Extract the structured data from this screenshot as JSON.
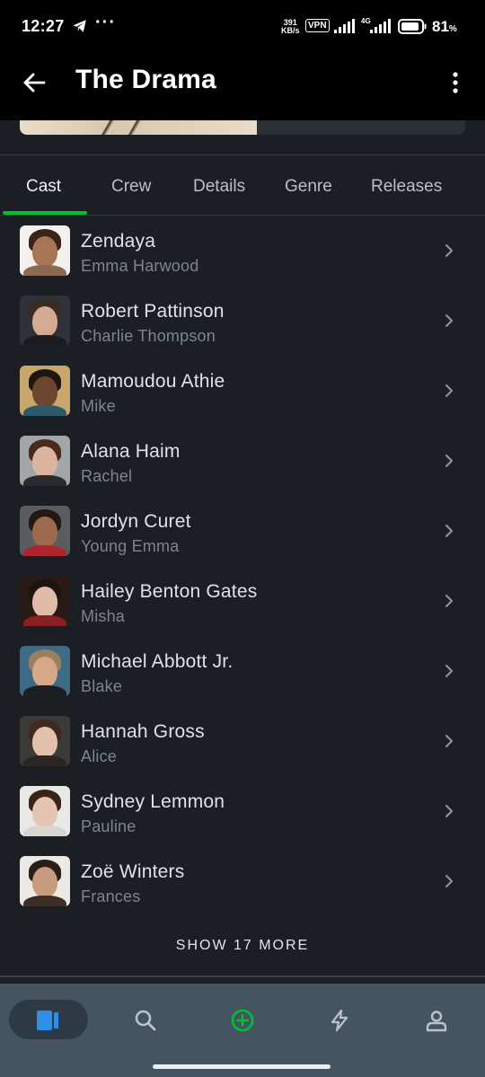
{
  "status_bar": {
    "time": "12:27",
    "dots": "···",
    "speed_value": "391",
    "speed_unit": "KB/s",
    "vpn": "VPN",
    "network": "4G",
    "battery": "81",
    "battery_unit": "%"
  },
  "app_bar": {
    "title": "The Drama"
  },
  "tabs": [
    {
      "label": "Cast"
    },
    {
      "label": "Crew"
    },
    {
      "label": "Details"
    },
    {
      "label": "Genre"
    },
    {
      "label": "Releases"
    }
  ],
  "cast": [
    {
      "name": "Zendaya",
      "role": "Emma Harwood"
    },
    {
      "name": "Robert Pattinson",
      "role": "Charlie Thompson"
    },
    {
      "name": "Mamoudou Athie",
      "role": "Mike"
    },
    {
      "name": "Alana Haim",
      "role": "Rachel"
    },
    {
      "name": "Jordyn Curet",
      "role": "Young Emma"
    },
    {
      "name": "Hailey Benton Gates",
      "role": "Misha"
    },
    {
      "name": "Michael Abbott Jr.",
      "role": "Blake"
    },
    {
      "name": "Hannah Gross",
      "role": "Alice"
    },
    {
      "name": "Sydney Lemmon",
      "role": "Pauline"
    },
    {
      "name": "Zoë Winters",
      "role": "Frances"
    }
  ],
  "show_more": "SHOW 17 MORE",
  "colors": {
    "accent": "#00c030",
    "background": "#1b1e22",
    "nav_background": "#445561"
  },
  "bottom_nav": [
    {
      "icon": "film-icon",
      "selected": true
    },
    {
      "icon": "search-icon"
    },
    {
      "icon": "add-circle-icon"
    },
    {
      "icon": "lightning-icon"
    },
    {
      "icon": "profile-icon"
    }
  ]
}
